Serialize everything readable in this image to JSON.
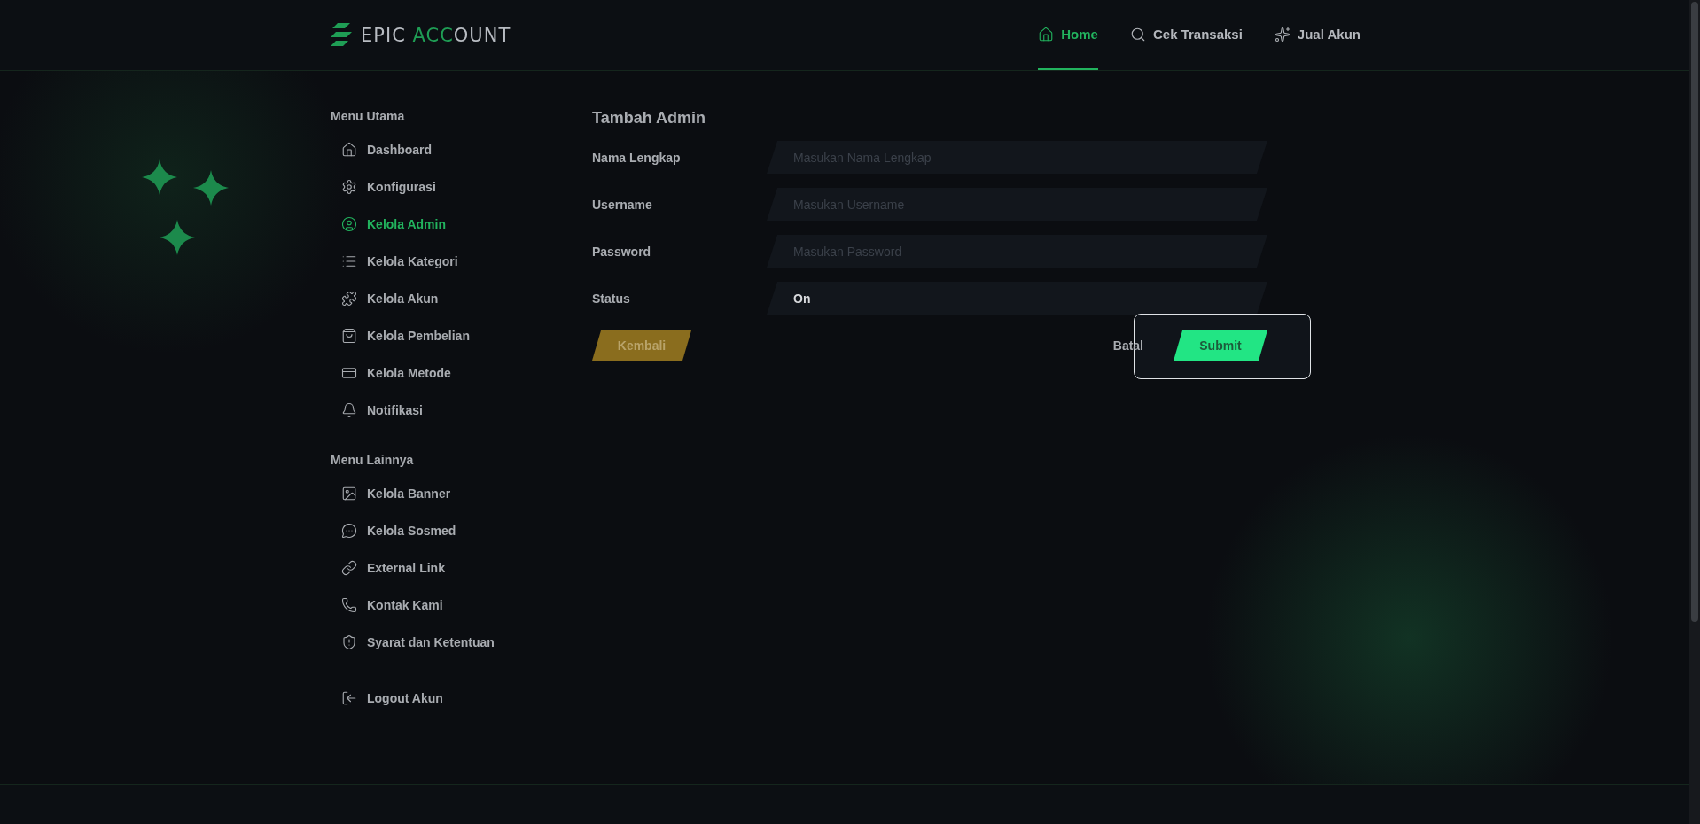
{
  "header": {
    "logo": {
      "part_1": "EPIC",
      "part_2": "ACC",
      "part_3": "OUNT"
    },
    "nav": [
      {
        "label": "Home",
        "selected": true
      },
      {
        "label": "Cek Transaksi",
        "selected": false
      },
      {
        "label": "Jual Akun",
        "selected": false
      }
    ]
  },
  "sidebar": {
    "sections": [
      {
        "title": "Menu Utama",
        "items": [
          {
            "label": "Dashboard",
            "selected": false
          },
          {
            "label": "Konfigurasi",
            "selected": false
          },
          {
            "label": "Kelola Admin",
            "selected": true
          },
          {
            "label": "Kelola Kategori",
            "selected": false
          },
          {
            "label": "Kelola Akun",
            "selected": false
          },
          {
            "label": "Kelola Pembelian",
            "selected": false
          },
          {
            "label": "Kelola Metode",
            "selected": false
          },
          {
            "label": "Notifikasi",
            "selected": false
          }
        ]
      },
      {
        "title": "Menu Lainnya",
        "items": [
          {
            "label": "Kelola Banner",
            "selected": false
          },
          {
            "label": "Kelola Sosmed",
            "selected": false
          },
          {
            "label": "External Link",
            "selected": false
          },
          {
            "label": "Kontak Kami",
            "selected": false
          },
          {
            "label": "Syarat dan Ketentuan",
            "selected": false
          }
        ]
      }
    ],
    "logout": {
      "label": "Logout Akun"
    }
  },
  "form": {
    "title": "Tambah Admin",
    "fields": [
      {
        "label": "Nama Lengkap",
        "placeholder": "Masukan Nama Lengkap"
      },
      {
        "label": "Username",
        "placeholder": "Masukan Username"
      },
      {
        "label": "Password",
        "placeholder": "Masukan Password"
      },
      {
        "label": "Status",
        "value": "On"
      }
    ],
    "back_button": "Kembali",
    "cancel_button": "Batal",
    "submit_button": "Submit"
  }
}
